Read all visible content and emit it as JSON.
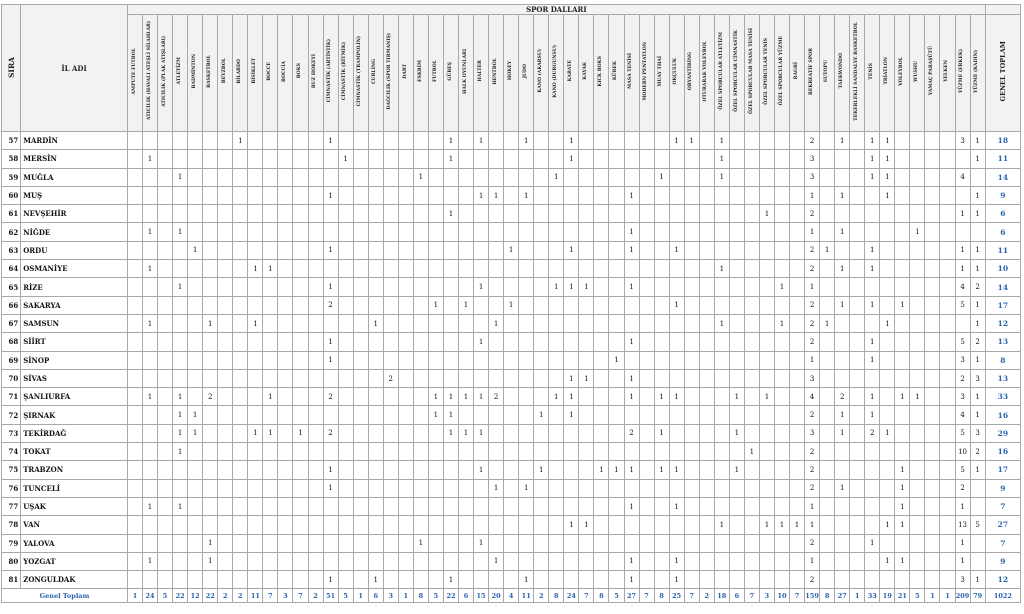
{
  "header": {
    "sira_label": "SIRA",
    "il_label": "İL ADI",
    "spor_dallari_label": "SPOR DALLARI",
    "total_label": "GENEL TOPLAM"
  },
  "sports": [
    "AMPUTE FUTBOL",
    "ATICILIK (HAVALI ATEŞLİ SİLAHLAR)",
    "ATICILIK (PLAK ATIŞLARI)",
    "ATLETİZM",
    "BADMİNTON",
    "BASKETBOL",
    "BEYZBOL",
    "BİLARDO",
    "BİSİKLET",
    "BOCCE",
    "BOCCİA",
    "BOKS",
    "BUZ HOKEYİ",
    "CİMNASTİK (ARTİSTİK)",
    "CİMNASTİK (RİTMİK)",
    "CİMNASTİK (TRAMPOLİN)",
    "CURLİNG",
    "DAĞCILIK (SPOR TIRMANIŞ)",
    "DART",
    "ESKRİM",
    "FUTBOL",
    "GÜREŞ",
    "HALK OYUNLARI",
    "HALTER",
    "HENTBOL",
    "HOKEY",
    "JUDO",
    "KANO (AKARSU)",
    "KANO (DURGUNSU)",
    "KARATE",
    "KAYAK",
    "KICK BOKS",
    "KÜREK",
    "MASA TENİSİ",
    "MODERN PENTATLON",
    "MUAY THAİ",
    "OKÇULUK",
    "ORYANTİRİNG",
    "OTURARAK VOLEYBOL",
    "ÖZEL SPORCULAR ATLETİZM",
    "ÖZEL SPORCULAR CİMNASTİK",
    "ÖZEL SPORCULAR MASA TENİSİ",
    "ÖZEL SPORCULAR TENİS",
    "ÖZEL SPORCULAR YÜZME",
    "RAGBİ",
    "REKREATİF SPOR",
    "SUTOPU",
    "TAEKWONDO",
    "TEKERLEKLİ SANDALYE BASKETBOL",
    "TENİS",
    "TRİATLON",
    "VOLEYBOL",
    "WUSHU",
    "YAMAÇ PARAŞÜTÜ",
    "YELKEN",
    "YÜZME (ERKEK)",
    "YÜZME (KADIN)"
  ],
  "rows": [
    {
      "no": "57",
      "il": "MARDİN",
      "c": {
        "7": "1",
        "13": "1",
        "21": "1",
        "23": "1",
        "26": "1",
        "29": "1",
        "36": "1",
        "37": "1",
        "39": "1",
        "45": "2",
        "47": "1",
        "49": "1",
        "50": "1",
        "55": "3",
        "56": "1"
      },
      "total": "18"
    },
    {
      "no": "58",
      "il": "MERSİN",
      "c": {
        "1": "1",
        "14": "1",
        "21": "1",
        "29": "1",
        "39": "1",
        "45": "3",
        "49": "1",
        "50": "1",
        "56": "1"
      },
      "total": "11"
    },
    {
      "no": "59",
      "il": "MUĞLA",
      "c": {
        "3": "1",
        "19": "1",
        "28": "1",
        "35": "1",
        "39": "1",
        "45": "3",
        "49": "1",
        "50": "1",
        "55": "4"
      },
      "total": "14"
    },
    {
      "no": "60",
      "il": "MUŞ",
      "c": {
        "13": "1",
        "23": "1",
        "24": "1",
        "26": "1",
        "33": "1",
        "45": "1",
        "47": "1",
        "50": "1",
        "56": "1"
      },
      "total": "9"
    },
    {
      "no": "61",
      "il": "NEVŞEHİR",
      "c": {
        "21": "1",
        "42": "1",
        "45": "2",
        "55": "1",
        "56": "1"
      },
      "total": "6"
    },
    {
      "no": "62",
      "il": "NİĞDE",
      "c": {
        "1": "1",
        "3": "1",
        "33": "1",
        "45": "1",
        "47": "1",
        "52": "1"
      },
      "total": "6"
    },
    {
      "no": "63",
      "il": "ORDU",
      "c": {
        "4": "1",
        "13": "1",
        "25": "1",
        "29": "1",
        "33": "1",
        "36": "1",
        "45": "2",
        "46": "1",
        "49": "1",
        "55": "1",
        "56": "1"
      },
      "total": "11"
    },
    {
      "no": "64",
      "il": "OSMANİYE",
      "c": {
        "1": "1",
        "8": "1",
        "9": "1",
        "39": "1",
        "45": "2",
        "47": "1",
        "49": "1",
        "55": "1",
        "56": "1"
      },
      "total": "10"
    },
    {
      "no": "65",
      "il": "RİZE",
      "c": {
        "3": "1",
        "13": "1",
        "23": "1",
        "28": "1",
        "29": "1",
        "30": "1",
        "33": "1",
        "43": "1",
        "45": "1",
        "55": "4",
        "56": "2"
      },
      "total": "14"
    },
    {
      "no": "66",
      "il": "SAKARYA",
      "c": {
        "13": "2",
        "20": "1",
        "22": "1",
        "25": "1",
        "36": "1",
        "45": "2",
        "47": "1",
        "49": "1",
        "51": "1",
        "55": "5",
        "56": "1"
      },
      "total": "17"
    },
    {
      "no": "67",
      "il": "SAMSUN",
      "c": {
        "1": "1",
        "5": "1",
        "8": "1",
        "16": "1",
        "24": "1",
        "39": "1",
        "43": "1",
        "45": "2",
        "46": "1",
        "50": "1",
        "56": "1"
      },
      "total": "12"
    },
    {
      "no": "68",
      "il": "SİİRT",
      "c": {
        "13": "1",
        "23": "1",
        "33": "1",
        "45": "2",
        "49": "1",
        "55": "5",
        "56": "2"
      },
      "total": "13"
    },
    {
      "no": "69",
      "il": "SİNOP",
      "c": {
        "13": "1",
        "32": "1",
        "45": "1",
        "49": "1",
        "55": "3",
        "56": "1"
      },
      "total": "8"
    },
    {
      "no": "70",
      "il": "SİVAS",
      "c": {
        "17": "2",
        "29": "1",
        "30": "1",
        "33": "1",
        "45": "3",
        "55": "2",
        "56": "3"
      },
      "total": "13"
    },
    {
      "no": "71",
      "il": "ŞANLIURFA",
      "c": {
        "1": "1",
        "3": "1",
        "5": "2",
        "9": "1",
        "13": "2",
        "20": "1",
        "21": "1",
        "22": "1",
        "23": "1",
        "24": "2",
        "28": "1",
        "29": "1",
        "33": "1",
        "35": "1",
        "36": "1",
        "40": "1",
        "42": "1",
        "45": "4",
        "47": "2",
        "49": "1",
        "51": "1",
        "52": "1",
        "55": "3",
        "56": "1"
      },
      "total": "33"
    },
    {
      "no": "72",
      "il": "ŞIRNAK",
      "c": {
        "3": "1",
        "4": "1",
        "20": "1",
        "21": "1",
        "27": "1",
        "29": "1",
        "45": "2",
        "47": "1",
        "49": "1",
        "55": "4",
        "56": "1"
      },
      "total": "16"
    },
    {
      "no": "73",
      "il": "TEKİRDAĞ",
      "c": {
        "3": "1",
        "4": "1",
        "8": "1",
        "9": "1",
        "11": "1",
        "13": "2",
        "21": "1",
        "22": "1",
        "23": "1",
        "33": "2",
        "35": "1",
        "40": "1",
        "45": "3",
        "47": "1",
        "49": "2",
        "50": "1",
        "55": "5",
        "56": "3"
      },
      "total": "29"
    },
    {
      "no": "74",
      "il": "TOKAT",
      "c": {
        "3": "1",
        "41": "1",
        "45": "2",
        "55": "10",
        "56": "2"
      },
      "total": "16"
    },
    {
      "no": "75",
      "il": "TRABZON",
      "c": {
        "13": "1",
        "23": "1",
        "27": "1",
        "31": "1",
        "32": "1",
        "33": "1",
        "35": "1",
        "36": "1",
        "40": "1",
        "45": "2",
        "51": "1",
        "55": "5",
        "56": "1"
      },
      "total": "17"
    },
    {
      "no": "76",
      "il": "TUNCELİ",
      "c": {
        "13": "1",
        "24": "1",
        "26": "1",
        "45": "2",
        "47": "1",
        "51": "1",
        "55": "2"
      },
      "total": "9"
    },
    {
      "no": "77",
      "il": "UŞAK",
      "c": {
        "1": "1",
        "3": "1",
        "33": "1",
        "36": "1",
        "45": "1",
        "51": "1",
        "55": "1"
      },
      "total": "7"
    },
    {
      "no": "78",
      "il": "VAN",
      "c": {
        "29": "1",
        "30": "1",
        "39": "1",
        "42": "1",
        "43": "1",
        "44": "1",
        "45": "1",
        "50": "1",
        "51": "1",
        "55": "13",
        "56": "5"
      },
      "total": "27"
    },
    {
      "no": "79",
      "il": "YALOVA",
      "c": {
        "5": "1",
        "19": "1",
        "23": "1",
        "45": "2",
        "49": "1",
        "55": "1"
      },
      "total": "7"
    },
    {
      "no": "80",
      "il": "YOZGAT",
      "c": {
        "1": "1",
        "5": "1",
        "24": "1",
        "33": "1",
        "36": "1",
        "45": "1",
        "50": "1",
        "51": "1",
        "55": "1"
      },
      "total": "9"
    },
    {
      "no": "81",
      "il": "ZONGULDAK",
      "c": {
        "13": "1",
        "16": "1",
        "21": "1",
        "26": "1",
        "33": "1",
        "36": "1",
        "45": "2",
        "55": "3",
        "56": "1"
      },
      "total": "12"
    }
  ],
  "footer": {
    "label": "Genel Toplam",
    "values": [
      "1",
      "24",
      "5",
      "22",
      "12",
      "22",
      "2",
      "2",
      "11",
      "7",
      "3",
      "7",
      "2",
      "51",
      "5",
      "1",
      "6",
      "3",
      "1",
      "8",
      "5",
      "22",
      "6",
      "15",
      "20",
      "4",
      "11",
      "2",
      "8",
      "24",
      "7",
      "8",
      "5",
      "27",
      "7",
      "8",
      "25",
      "7",
      "2",
      "18",
      "6",
      "7",
      "3",
      "10",
      "7",
      "159",
      "8",
      "27",
      "1",
      "33",
      "19",
      "21",
      "5",
      "1",
      "1",
      "209",
      "79"
    ],
    "total": "1022"
  }
}
